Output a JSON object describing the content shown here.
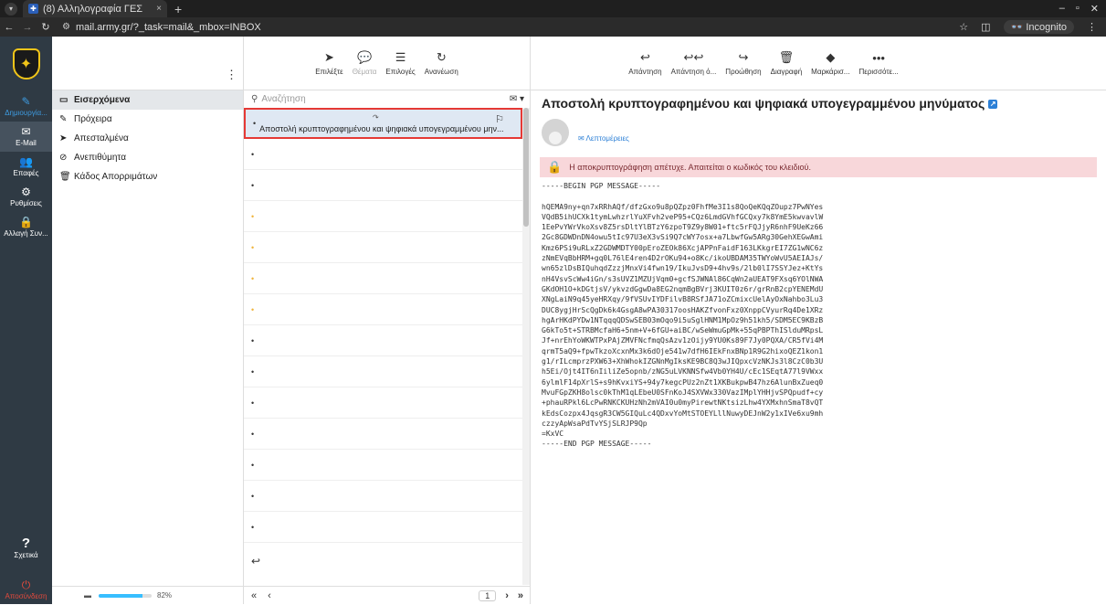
{
  "browser": {
    "tab_title": "(8) Αλληλογραφία ΓΕΣ",
    "tab_close": "×",
    "new_tab": "+",
    "url": "mail.army.gr/?_task=mail&_mbox=INBOX",
    "incognito_label": "Incognito",
    "favicon_icon": "army-favicon"
  },
  "nav_rail": {
    "items": [
      {
        "label": "Δημιουργία...",
        "icon": "compose-icon"
      },
      {
        "label": "E-Mail",
        "icon": "mail-icon"
      },
      {
        "label": "Επαφές",
        "icon": "contacts-icon"
      },
      {
        "label": "Ρυθμίσεις",
        "icon": "gear-icon"
      },
      {
        "label": "Αλλαγή Συν...",
        "icon": "lock-icon"
      }
    ],
    "about_label": "Σχετικά",
    "logout_label": "Αποσύνδεση"
  },
  "folders": {
    "items": [
      {
        "label": "Εισερχόμενα",
        "icon": "inbox-icon"
      },
      {
        "label": "Πρόχειρα",
        "icon": "pencil-icon"
      },
      {
        "label": "Απεσταλμένα",
        "icon": "send-icon"
      },
      {
        "label": "Ανεπιθύμητα",
        "icon": "spam-icon"
      },
      {
        "label": "Κάδος Απορριμάτων",
        "icon": "trash-icon"
      }
    ],
    "quota_text": "82%",
    "quota_fraction": 0.82
  },
  "list_toolbar": {
    "select_label": "Επιλέξτε",
    "threads_label": "Θέματα",
    "options_label": "Επιλογές",
    "refresh_label": "Ανανέωση"
  },
  "search": {
    "placeholder": "Αναζήτηση"
  },
  "messages": {
    "selected_subject": "Αποστολή κρυπτογραφημένου και ψηφιακά υπογεγραμμένου μην..."
  },
  "pager": {
    "first": "«",
    "prev": "‹",
    "page": "1",
    "next": "›",
    "last": "»"
  },
  "reading_toolbar": {
    "reply_label": "Απάντηση",
    "reply_all_label": "Απάντηση ό...",
    "forward_label": "Προώθηση",
    "delete_label": "Διαγραφή",
    "mark_label": "Μαρκάρισ...",
    "more_label": "Περισσότε..."
  },
  "message": {
    "subject": "Αποστολή κρυπτογραφημένου και ψηφιακά υπογεγραμμένου μηνύματος",
    "details_label": "Λεπτομέρειες",
    "alert_text": "Η αποκρυπτογράφηση απέτυχε. Απαιτείται ο κωδικός του κλειδιού.",
    "body": "-----BEGIN PGP MESSAGE-----\n\nhQEMA9ny+qn7xRRhAQf/dfzGxo9u8pQZpz0FhfMe3I1s8QoQeKQqZOupz7PwNYes\nVQdB5ihUCXk1tymLwhzrlYuXFvh2veP95+CQz6LmdGVhfGCQxy7k8YmE5kwvavlW\n1EePvYWrVkoXsv8Z5rsDltYlBTzY6zpoT9Z9y8W01+ftc5rFQJjyR6nhF9UeKz66\n2Gc8GDWDnDN4owu5tIc97U3eX3vSi9Q7cWY7osx+a7LbwfGw5ARg30GehXEGwAmi\nKmz6PSi9uRLxZ2GDWMDTY00pEroZEOk86XcjAPPnFaidF163LKkgrEI7ZG1wNC6z\nzNmEVqBbHRM+gq0L76lE4ren4D2rOKu94+o8Kc/ikoUBDAM35TWYoWvU5AEIAJs/\nwn65zlDsBIQuhqdZzzjMnxVi4fwn19/IkuJvsD9+4hv9s/2lb0lI7SSYJez+KtYs\nnH4VsvScWw4iGn/s3sUVZ1MZUjVqm0+gcfSJWNAl86CqWn2aUEAT9FXsq6YOlNWA\nGKdOH1O+kDGtjsV/ykvzdGgwDa8EG2nqmBgBVrj3KUIT0z6r/grRnB2cpYENEMdU\nXNgLaiN9q45yeHRXqy/9fVSUvIYDFilvB8RSfJA71oZCmixcUelAyOxNahbo3Lu3\nDUC8ygjHrScQgDk6k4GsgA8wPA30317oosHAKZfvonFxz0XnppCVyurRq4De1XRz\nhgArHKdPYDw1NTqqqQDSwSEB03mOqo9i5uSglHNM1MpOz9h51kh5/SDM5EC9KBzB\nG6kTo5t+STRBMcfaH6+5nm+V+6fGU+aiBC/wSeWmuGpMk+55qPBPThISlduMRpsL\nJf+nrEhYoWKWTPxPAjZMVFNcfmqQsAzv1zOijy9YU0Ks89F7Jy0PQXA/CR5fVi4M\nqrmT5aQ9+fpwTkzoXcxnMx3k6dOje541w7dfH6IEkFnxBNp1R9G2hixoQEZ1kon1\ng1/rILcmprzPXW63+XhWhokIZGNnMgIksKE9BC8Q3wJIQpxcVzNKJs3l8CzC0b3U\nh5Ei/Ojt4IT6nIiliZe5opnb/zNG5uLVKNNSfw4Vb0YH4U/cEc1SEqtA77l9VWxx\n6ylmlF14pXrlS+s9hKvxiYS+94y7kegcPUz2nZt1XKBukpwB47hz6AlunBxZueq0\nMvuFGpZKH8olsc0kThM1qLEbeU0SFnKoJ4SXVWx330VazIMplYHHjvSPQpudf+cy\n+phauRPkl6LcPwRNKCKUHzNh2mVAI0u0myPirewtNKtsizLhw4YXMxhnSmaT8vQT\nkEdsCozpx4JqsgR3CW5GIQuLc4QDxvYoMtSTOEYLllNuwyDEJnW2y1xIVe6xu9mh\nczzyApWsaPdTvYSjSLRJP9Qp\n=KxVC\n-----END PGP MESSAGE-----"
  }
}
